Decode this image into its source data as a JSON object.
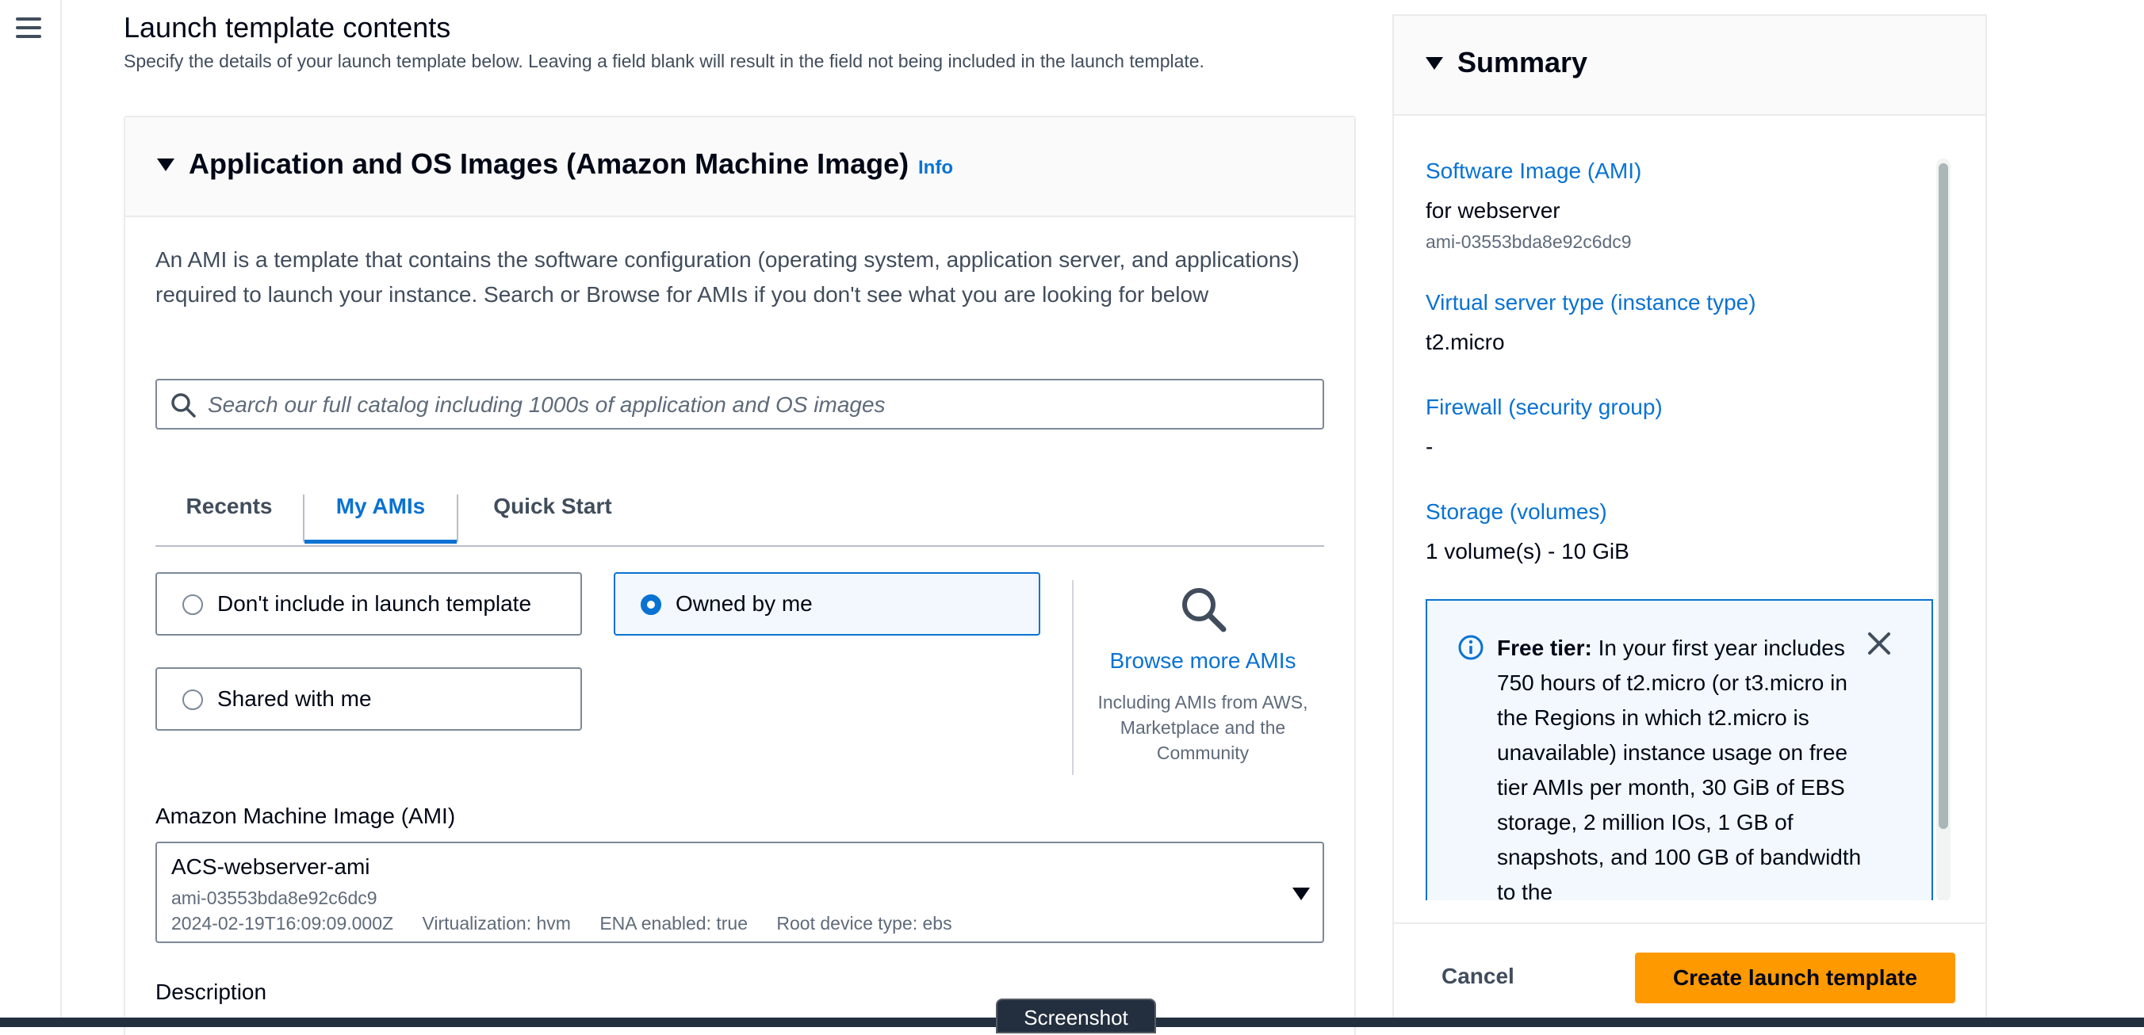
{
  "nav": {
    "menu_icon": "hamburger-menu-icon"
  },
  "header": {
    "title": "Launch template contents",
    "description": "Specify the details of your launch template below. Leaving a field blank will result in the field not being included in the launch template."
  },
  "ami_section": {
    "title": "Application and OS Images (Amazon Machine Image)",
    "info_link": "Info",
    "description": "An AMI is a template that contains the software configuration (operating system, application server, and applications) required to launch your instance. Search or Browse for AMIs if you don't see what you are looking for below",
    "search": {
      "placeholder": "Search our full catalog including 1000s of application and OS images",
      "value": ""
    },
    "tabs": [
      {
        "label": "Recents",
        "active": false
      },
      {
        "label": "My AMIs",
        "active": true
      },
      {
        "label": "Quick Start",
        "active": false
      }
    ],
    "options": [
      {
        "label": "Don't include in launch template",
        "checked": false
      },
      {
        "label": "Owned by me",
        "checked": true
      },
      {
        "label": "Shared with me",
        "checked": false
      }
    ],
    "browse": {
      "title": "Browse more AMIs",
      "subtitle": "Including AMIs from AWS, Marketplace and the Community"
    },
    "ami_field": {
      "label": "Amazon Machine Image (AMI)",
      "name": "ACS-webserver-ami",
      "id": "ami-03553bda8e92c6dc9",
      "date": "2024-02-19T16:09:09.000Z",
      "virtualization": "Virtualization: hvm",
      "ena": "ENA enabled: true",
      "root_device": "Root device type: ebs"
    },
    "description_label": "Description"
  },
  "summary": {
    "title": "Summary",
    "software_image_label": "Software Image (AMI)",
    "software_image_value": "for webserver",
    "software_image_id": "ami-03553bda8e92c6dc9",
    "instance_type_label": "Virtual server type (instance type)",
    "instance_type_value": "t2.micro",
    "firewall_label": "Firewall (security group)",
    "firewall_value": "-",
    "storage_label": "Storage (volumes)",
    "storage_value": "1 volume(s) - 10 GiB",
    "free_tier": {
      "title": "Free tier:",
      "text": "In your first year includes 750 hours of t2.micro (or t3.micro in the Regions in which t2.micro is unavailable) instance usage on free tier AMIs per month, 30 GiB of EBS storage, 2 million IOs, 1 GB of snapshots, and 100 GB of bandwidth to the"
    },
    "cancel_label": "Cancel",
    "create_label": "Create launch template"
  },
  "overlay": {
    "tooltip": "Screenshot"
  },
  "colors": {
    "accent": "#0972d3",
    "primary_button": "#ff9900",
    "text": "#000716"
  }
}
